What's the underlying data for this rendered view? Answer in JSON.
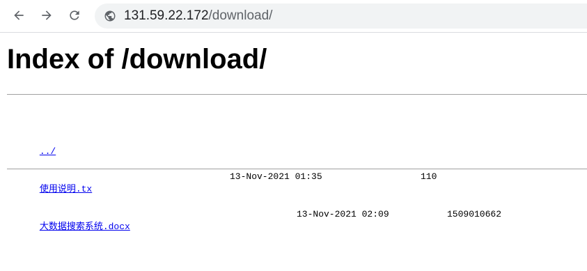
{
  "browser": {
    "url_host": "131.59.22.172",
    "url_path": "/download/",
    "icons": {
      "back": "arrow-left-icon",
      "forward": "arrow-right-icon",
      "reload": "reload-icon",
      "site_info": "globe-icon"
    }
  },
  "page": {
    "title": "Index of /download/",
    "entries": [
      {
        "name": "../",
        "date": "",
        "size": ""
      },
      {
        "name": "使用说明.tx",
        "date": "13-Nov-2021 01:35",
        "size": "110"
      },
      {
        "name": "大数据搜索系统.docx",
        "date": "13-Nov-2021 02:09",
        "size": "1509010662"
      }
    ]
  },
  "colors": {
    "link": "#0000ee",
    "rule": "#a0a0a0",
    "omnibox_bg": "#f1f3f4"
  }
}
